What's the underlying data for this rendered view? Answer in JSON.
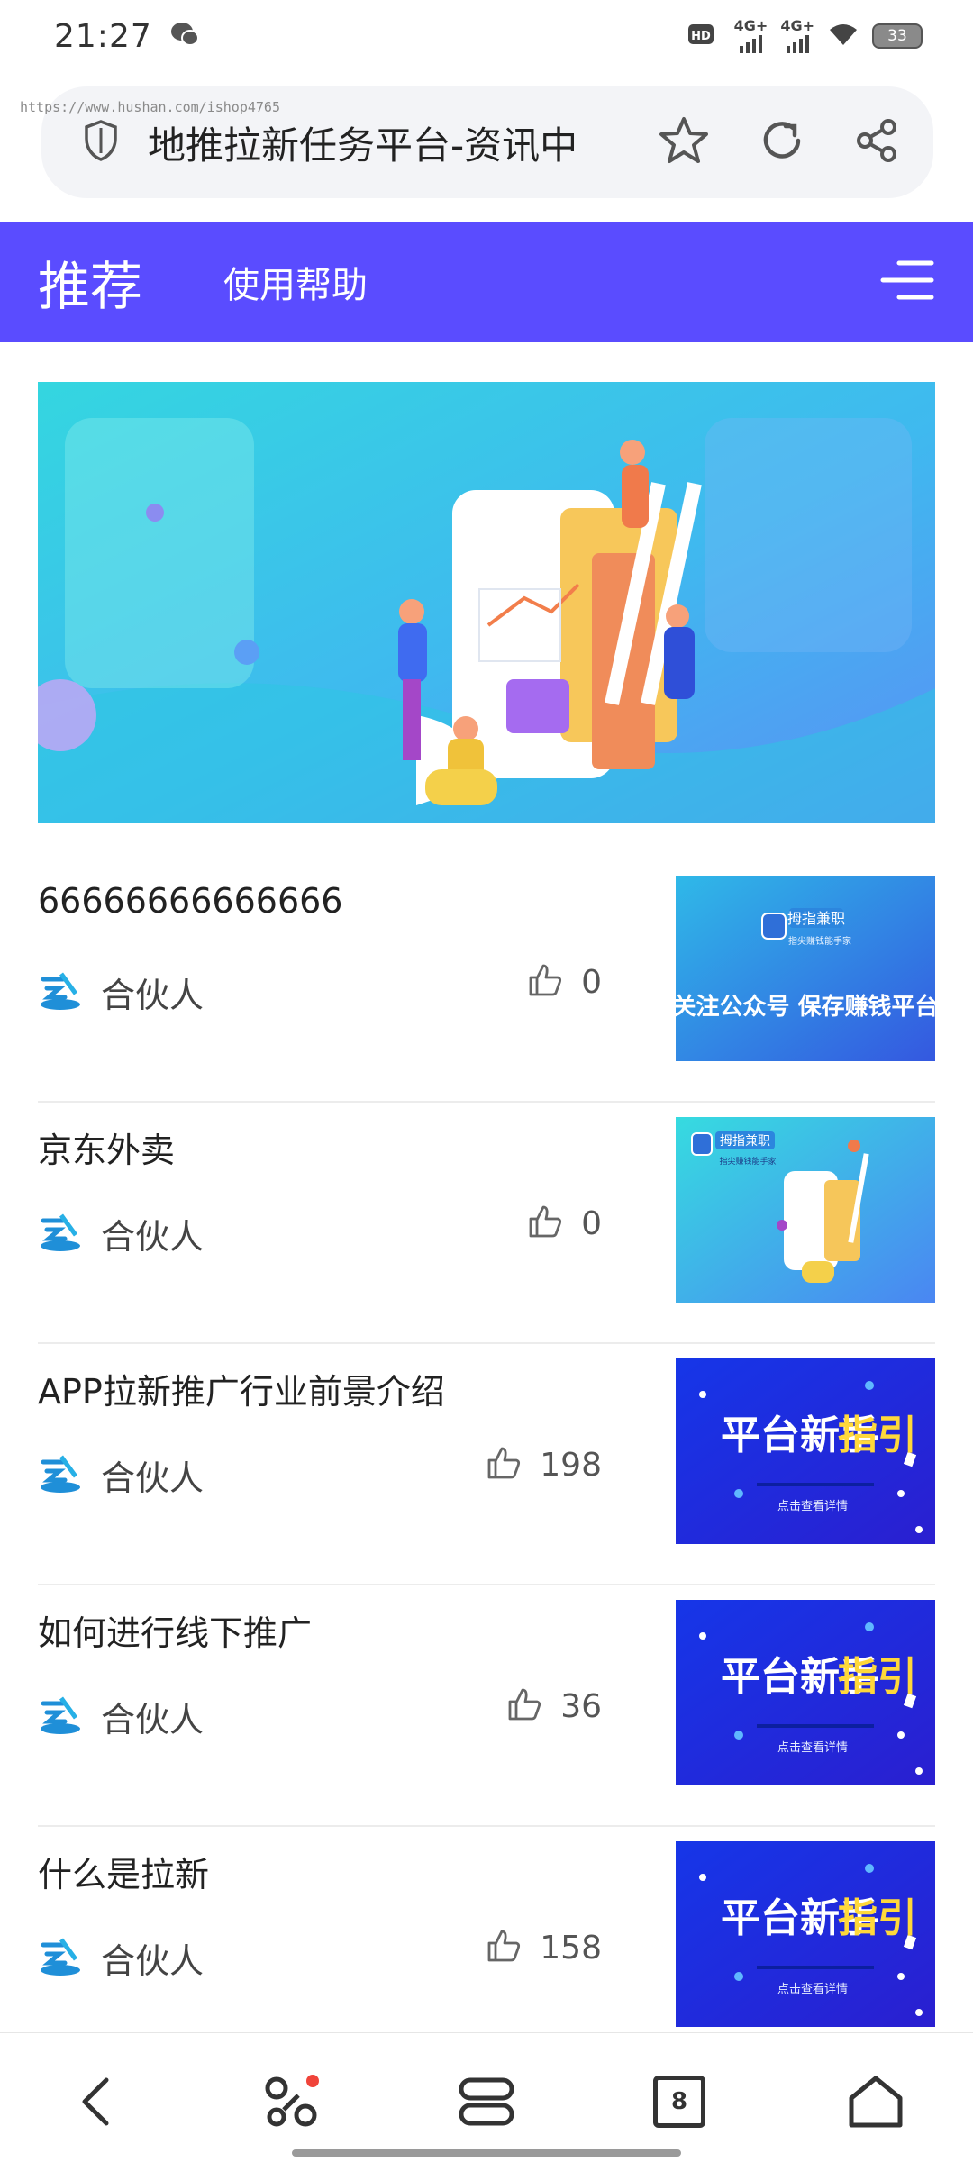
{
  "status_bar": {
    "time": "21:27",
    "network1": "4G+",
    "network2": "4G+",
    "battery": "33"
  },
  "browser": {
    "url_watermark": "https://www.hushan.com/ishop4765",
    "page_title": "地推拉新任务平台-资讯中",
    "icons": [
      "shield-icon",
      "star-icon",
      "refresh-icon",
      "share-icon"
    ]
  },
  "nav": {
    "active_tab": "推荐",
    "tab2": "使用帮助",
    "menu_icon": "menu-icon",
    "accent_color": "#5a4cff"
  },
  "articles": [
    {
      "title": "66666666666666",
      "author": "合伙人",
      "likes": "0",
      "thumb": {
        "type": "promo-qr",
        "brand": "拇指兼职",
        "tagline": "指尖赚钱能手家",
        "headline": "关注公众号 保存赚钱平台"
      }
    },
    {
      "title": "京东外卖",
      "author": "合伙人",
      "likes": "0",
      "thumb": {
        "type": "promo-illustration",
        "brand": "拇指兼职",
        "tagline": "指尖赚钱能手家"
      }
    },
    {
      "title": "APP拉新推广行业前景介绍",
      "author": "合伙人",
      "likes": "198",
      "thumb": {
        "type": "guide",
        "headline_a": "平台新手",
        "headline_b": "指引",
        "sub": "点击查看详情"
      }
    },
    {
      "title": "如何进行线下推广",
      "author": "合伙人",
      "likes": "36",
      "thumb": {
        "type": "guide",
        "headline_a": "平台新手",
        "headline_b": "指引",
        "sub": "点击查看详情"
      }
    },
    {
      "title": "什么是拉新",
      "author": "合伙人",
      "likes": "158",
      "thumb": {
        "type": "guide",
        "headline_a": "平台新手",
        "headline_b": "指引",
        "sub": "点击查看详情"
      }
    }
  ],
  "bottom_bar": {
    "tab_count": "8",
    "icons": [
      "back-icon",
      "apps-icon",
      "tabs-stack-icon",
      "tab-count-icon",
      "home-icon"
    ]
  }
}
